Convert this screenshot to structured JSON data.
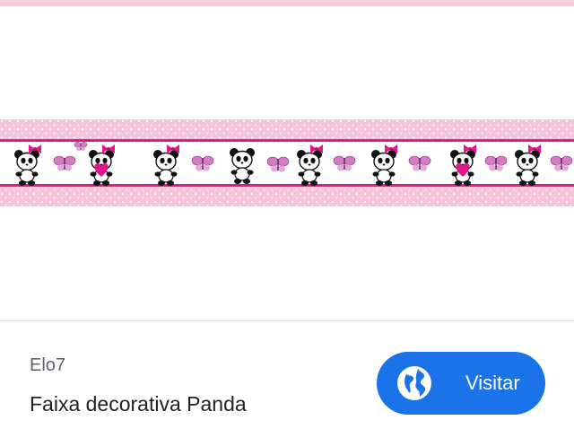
{
  "result": {
    "source": "Elo7",
    "title": "Faixa decorativa Panda",
    "visit_label": "Visitar",
    "visit_icon": "globe-icon"
  },
  "colors": {
    "accent": "#1a73e8",
    "banner_pink": "#f6c4da",
    "banner_magenta": "#e0188c",
    "butterfly": "#d67bc3"
  }
}
